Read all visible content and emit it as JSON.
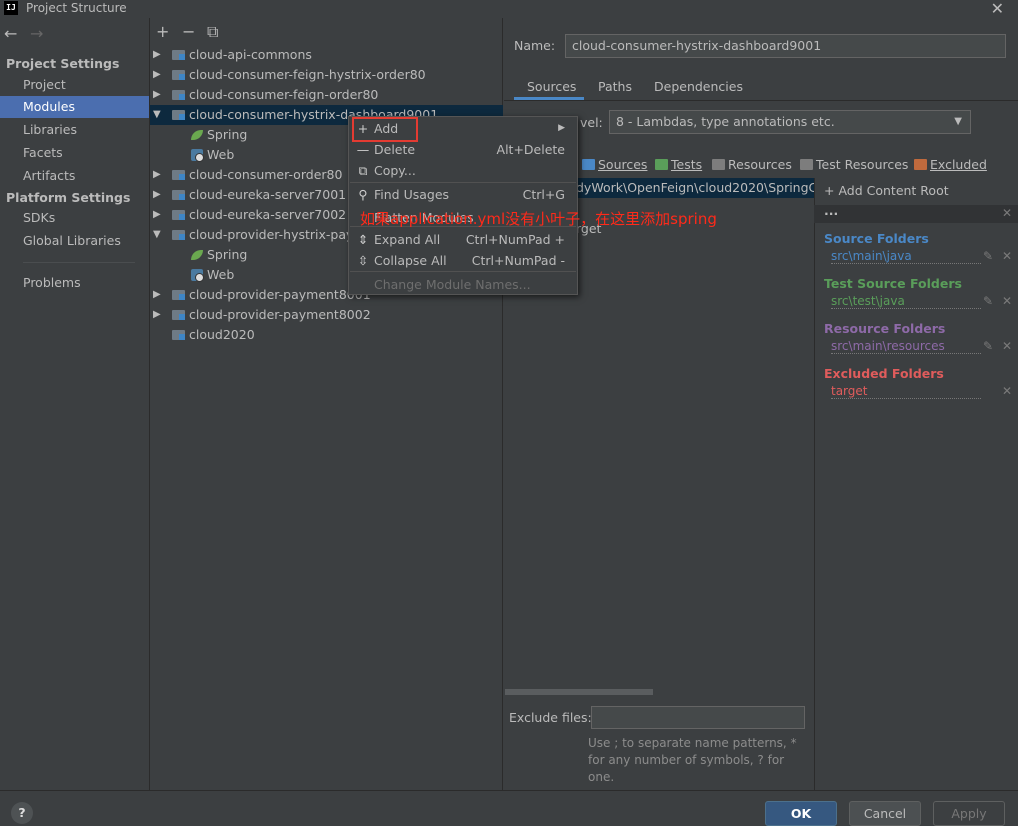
{
  "window": {
    "title": "Project Structure",
    "logo_text": "IJ",
    "close_icon": "close-icon"
  },
  "nav": {
    "back": "←",
    "forward": "→"
  },
  "sidebar": {
    "project_settings_header": "Project Settings",
    "project_items": [
      {
        "label": "Project"
      },
      {
        "label": "Modules",
        "selected": true
      },
      {
        "label": "Libraries"
      },
      {
        "label": "Facets"
      },
      {
        "label": "Artifacts"
      }
    ],
    "platform_settings_header": "Platform Settings",
    "platform_items": [
      {
        "label": "SDKs"
      },
      {
        "label": "Global Libraries"
      }
    ],
    "problems": "Problems"
  },
  "toolbar": {
    "add": "+",
    "remove": "−",
    "copy": "⧉"
  },
  "tree": [
    {
      "label": "cloud-api-commons",
      "kind": "module",
      "expand": "▶"
    },
    {
      "label": "cloud-consumer-feign-hystrix-order80",
      "kind": "module",
      "expand": "▶"
    },
    {
      "label": "cloud-consumer-feign-order80",
      "kind": "module",
      "expand": "▶"
    },
    {
      "label": "cloud-consumer-hystrix-dashboard9001",
      "kind": "module",
      "expand": "▼",
      "selected": true
    },
    {
      "label": "Spring",
      "kind": "spring"
    },
    {
      "label": "Web",
      "kind": "web"
    },
    {
      "label": "cloud-consumer-order80",
      "kind": "module",
      "expand": "▶"
    },
    {
      "label": "cloud-eureka-server7001",
      "kind": "module",
      "expand": "▶"
    },
    {
      "label": "cloud-eureka-server7002",
      "kind": "module",
      "expand": "▶"
    },
    {
      "label": "cloud-provider-hystrix-paym",
      "kind": "module",
      "expand": "▼"
    },
    {
      "label": "Spring",
      "kind": "spring"
    },
    {
      "label": "Web",
      "kind": "web"
    },
    {
      "label": "cloud-provider-payment8001",
      "kind": "module",
      "expand": "▶"
    },
    {
      "label": "cloud-provider-payment8002",
      "kind": "module",
      "expand": "▶"
    },
    {
      "label": "cloud2020",
      "kind": "module",
      "expand": ""
    }
  ],
  "context_menu": {
    "items": [
      {
        "icon": "+",
        "label": "Add",
        "shortcut": "",
        "submenu": "▶"
      },
      {
        "icon": "—",
        "label": "Delete",
        "shortcut": "Alt+Delete"
      },
      {
        "icon": "⧉",
        "label": "Copy...",
        "shortcut": ""
      },
      {
        "icon": "⚲",
        "label": "Find Usages",
        "shortcut": "Ctrl+G"
      },
      {
        "icon": "",
        "label": "Flatten Modules",
        "shortcut": ""
      },
      {
        "icon": "⇕",
        "label": "Expand All",
        "shortcut": "Ctrl+NumPad +"
      },
      {
        "icon": "⇳",
        "label": "Collapse All",
        "shortcut": "Ctrl+NumPad -"
      },
      {
        "icon": "",
        "label": "Change Module Names...",
        "shortcut": "",
        "disabled": true
      }
    ]
  },
  "annotation": "如果application.yml没有小叶子，在这里添加spring",
  "module": {
    "name_label": "Name:",
    "name_value": "cloud-consumer-hystrix-dashboard9001",
    "tabs": [
      {
        "label": "Sources",
        "active": true
      },
      {
        "label": "Paths"
      },
      {
        "label": "Dependencies"
      }
    ],
    "level_label": "vel:",
    "level_value": "8 - Lambdas, type annotations etc.",
    "mark_as": [
      {
        "label": "Sources",
        "color": "#4a88c7"
      },
      {
        "label": "Tests",
        "color": "#5a9e5a"
      },
      {
        "label": "Resources",
        "color": "#7d7d7d"
      },
      {
        "label": "Test Resources",
        "color": "#7d7d7d"
      },
      {
        "label": "Excluded",
        "color": "#c06a3d"
      }
    ],
    "root_path": "dyWork\\OpenFeign\\cloud2020\\SpringCl",
    "target_fragment": "rget",
    "exclude_label": "Exclude files:",
    "exclude_value": "",
    "exclude_hint": "Use ; to separate name patterns, * for any number of symbols, ? for one."
  },
  "content_root": {
    "add_label": "+ Add Content Root",
    "header": "...",
    "groups": [
      {
        "title": "Source Folders",
        "path": "src\\main\\java",
        "title_color": "#4a88c7",
        "path_color": "#4a88c7"
      },
      {
        "title": "Test Source Folders",
        "path": "src\\test\\java",
        "title_color": "#5a9e5a",
        "path_color": "#5a9e5a"
      },
      {
        "title": "Resource Folders",
        "path": "src\\main\\resources",
        "title_color": "#8e6aa8",
        "path_color": "#8e6aa8"
      },
      {
        "title": "Excluded Folders",
        "path": "target",
        "title_color": "#e05c5c",
        "path_color": "#e05c5c"
      }
    ]
  },
  "footer": {
    "help": "?",
    "ok": "OK",
    "cancel": "Cancel",
    "apply": "Apply"
  }
}
